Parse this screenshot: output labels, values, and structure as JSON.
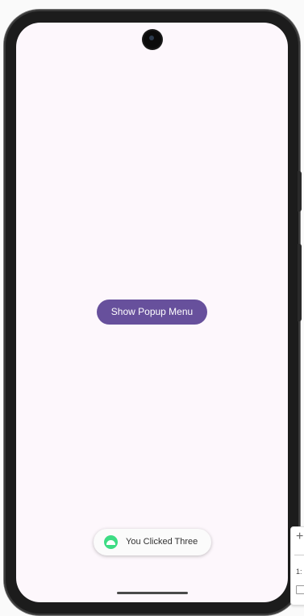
{
  "app": {
    "main_button_label": "Show Popup Menu"
  },
  "toast": {
    "message": "You Clicked Three",
    "icon": "android-robot-icon"
  },
  "emulator_toolbar": {
    "zoom_in_glyph": "+",
    "partial_label": "1:"
  },
  "colors": {
    "button_bg": "#67509c",
    "screen_bg": "#fdf7fc",
    "toast_icon": "#3ddc84"
  }
}
